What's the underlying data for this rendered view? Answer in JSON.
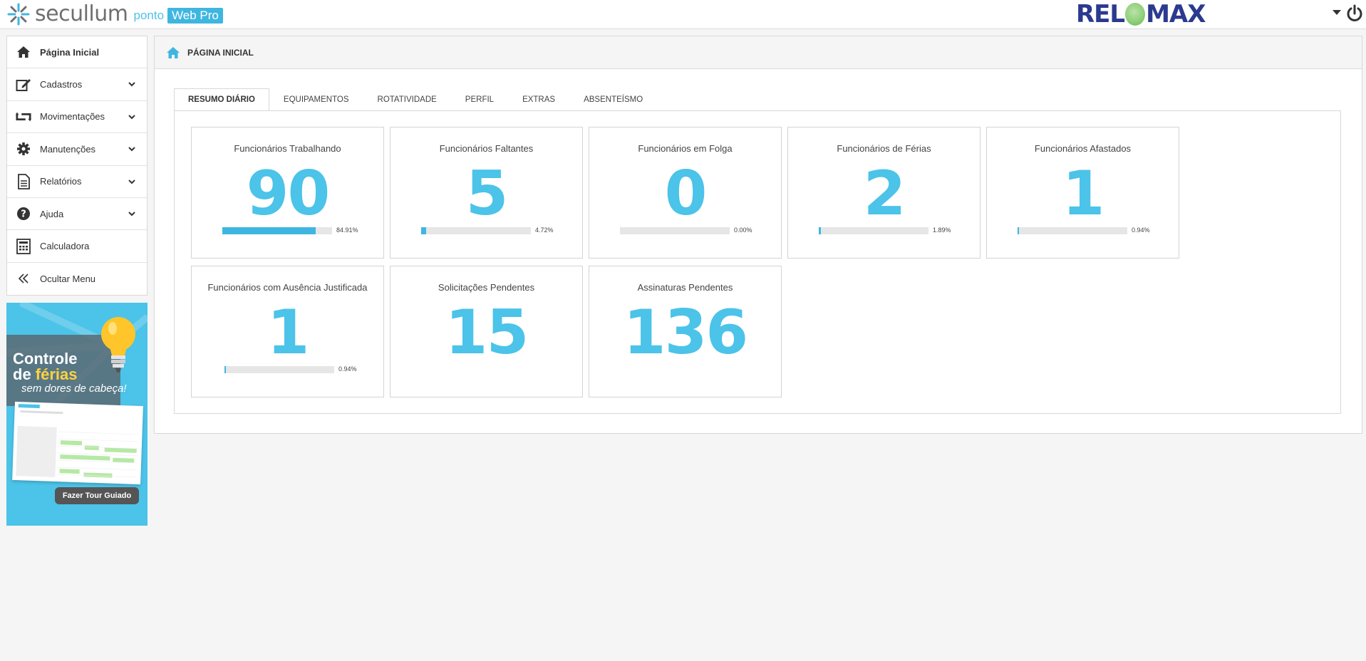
{
  "header": {
    "logo_text": "secullum",
    "logo_ponto": "ponto",
    "logo_webpro": "Web Pro",
    "brand_left": "REL",
    "brand_right": "MAX"
  },
  "sidebar": {
    "items": [
      {
        "label": "Página Inicial",
        "icon": "home-icon",
        "expandable": false,
        "active": true
      },
      {
        "label": "Cadastros",
        "icon": "edit-icon",
        "expandable": true
      },
      {
        "label": "Movimentações",
        "icon": "retweet-icon",
        "expandable": true
      },
      {
        "label": "Manutenções",
        "icon": "gear-icon",
        "expandable": true
      },
      {
        "label": "Relatórios",
        "icon": "document-icon",
        "expandable": true
      },
      {
        "label": "Ajuda",
        "icon": "question-icon",
        "expandable": true
      },
      {
        "label": "Calculadora",
        "icon": "calculator-icon",
        "expandable": false
      },
      {
        "label": "Ocultar Menu",
        "icon": "double-chevron-left-icon",
        "expandable": false
      }
    ]
  },
  "promo": {
    "line1": "Controle",
    "line2_prefix": "de ",
    "line2_highlight": "férias",
    "subtitle": "sem dores de cabeça!",
    "button": "Fazer Tour Guiado",
    "accent_color": "#4cc3e8",
    "highlight_color": "#ffd23f"
  },
  "main": {
    "title": "PÁGINA INICIAL",
    "tabs": [
      {
        "label": "RESUMO DIÁRIO",
        "active": true
      },
      {
        "label": "EQUIPAMENTOS"
      },
      {
        "label": "ROTATIVIDADE"
      },
      {
        "label": "PERFIL"
      },
      {
        "label": "EXTRAS"
      },
      {
        "label": "ABSENTEÍSMO"
      }
    ],
    "cards": [
      {
        "title": "Funcionários Trabalhando",
        "value": "90",
        "percent": "84.91%",
        "fraction": 0.8491
      },
      {
        "title": "Funcionários Faltantes",
        "value": "5",
        "percent": "4.72%",
        "fraction": 0.0472
      },
      {
        "title": "Funcionários em Folga",
        "value": "0",
        "percent": "0.00%",
        "fraction": 0
      },
      {
        "title": "Funcionários de Férias",
        "value": "2",
        "percent": "1.89%",
        "fraction": 0.0189
      },
      {
        "title": "Funcionários Afastados",
        "value": "1",
        "percent": "0.94%",
        "fraction": 0.0094
      },
      {
        "title": "Funcionários com Ausência Justificada",
        "value": "1",
        "percent": "0.94%",
        "fraction": 0.0094
      },
      {
        "title": "Solicitações Pendentes",
        "value": "15"
      },
      {
        "title": "Assinaturas Pendentes",
        "value": "136"
      }
    ]
  },
  "colors": {
    "accent": "#4cc3e8",
    "bar_fill": "#3fb6e0",
    "bar_track": "#e6e6e6",
    "brand": "#2b3a8f"
  }
}
